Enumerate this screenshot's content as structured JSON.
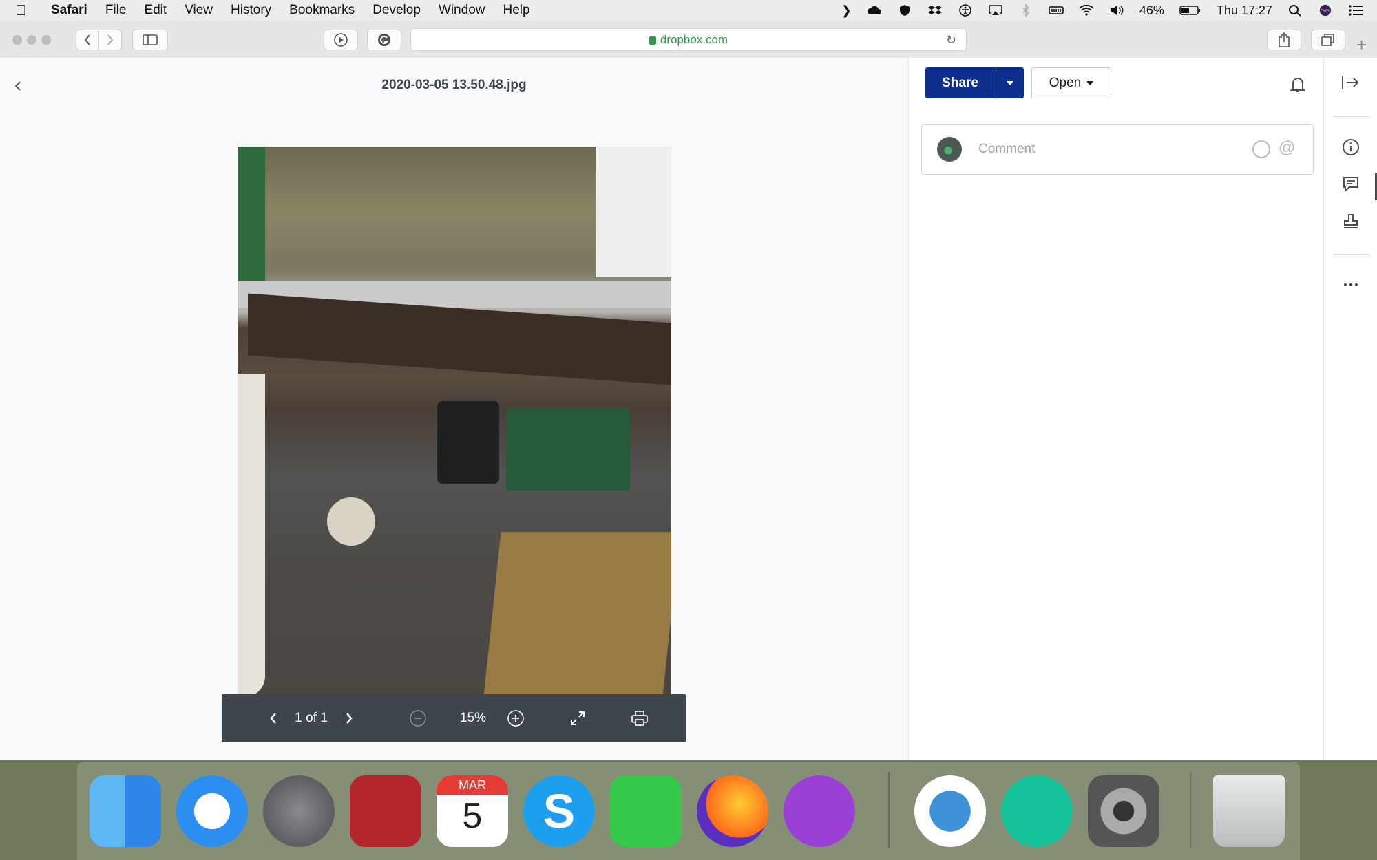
{
  "menubar": {
    "app_name": "Safari",
    "menus": [
      "File",
      "Edit",
      "View",
      "History",
      "Bookmarks",
      "Develop",
      "Window",
      "Help"
    ],
    "battery": "46%",
    "clock": "Thu 17:27"
  },
  "browser": {
    "url": "dropbox.com"
  },
  "viewer": {
    "filename": "2020-03-05 13.50.48.jpg",
    "page_indicator": "1 of 1",
    "zoom": "15%"
  },
  "panel": {
    "share_label": "Share",
    "open_label": "Open",
    "comment_placeholder": "Comment"
  },
  "dock": {
    "calendar_month": "MAR",
    "calendar_day": "5",
    "apps": [
      "finder",
      "safari",
      "launchpad",
      "photo-booth",
      "calendar",
      "skype",
      "facetime",
      "firefox",
      "podcasts",
      "simplenote",
      "grammarly",
      "system-preferences",
      "trash"
    ]
  },
  "colors": {
    "share_blue": "#0f2f8f",
    "controls_bg": "#3e454d",
    "url_green": "#2a9b4a"
  }
}
